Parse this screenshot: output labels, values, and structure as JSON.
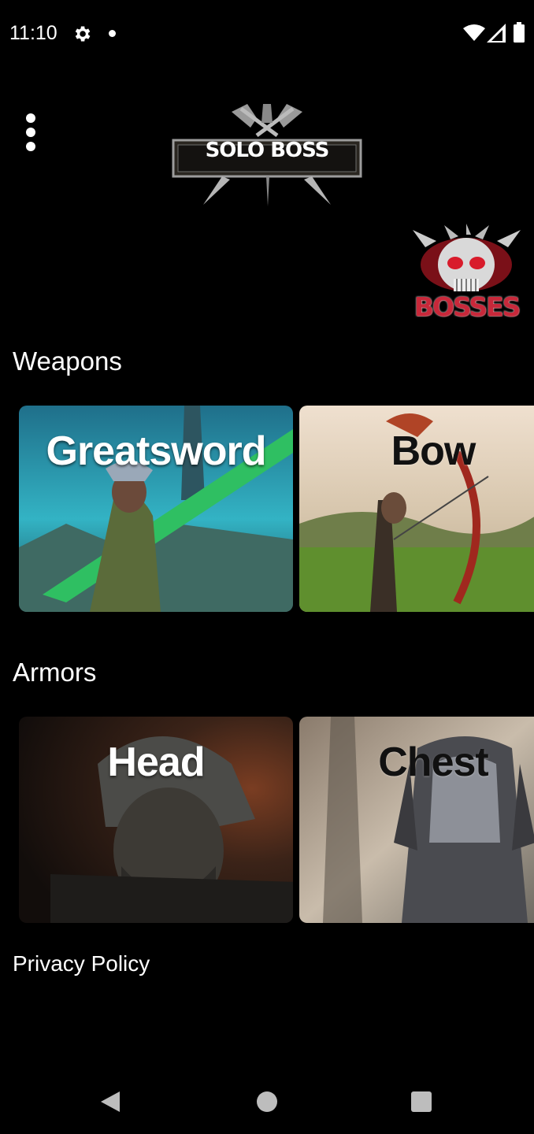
{
  "status_bar": {
    "time": "11:10",
    "icons": [
      "gear-icon",
      "notification-dot-icon",
      "wifi-icon",
      "signal-icon",
      "battery-icon"
    ]
  },
  "header": {
    "logo_text": "SOLO BOSS",
    "menu_icon": "overflow-menu-icon",
    "bosses_label": "BOSSES"
  },
  "weapons": {
    "title": "Weapons",
    "cards": [
      {
        "label": "Greatsword"
      },
      {
        "label": "Bow"
      }
    ]
  },
  "armors": {
    "title": "Armors",
    "cards": [
      {
        "label": "Head"
      },
      {
        "label": "Chest"
      }
    ]
  },
  "footer": {
    "privacy_label": "Privacy Policy"
  },
  "nav_bar": {
    "icons": [
      "back-icon",
      "home-icon",
      "recents-icon"
    ]
  },
  "colors": {
    "background": "#000000",
    "text": "#ffffff",
    "bosses_red": "#c8283a"
  }
}
